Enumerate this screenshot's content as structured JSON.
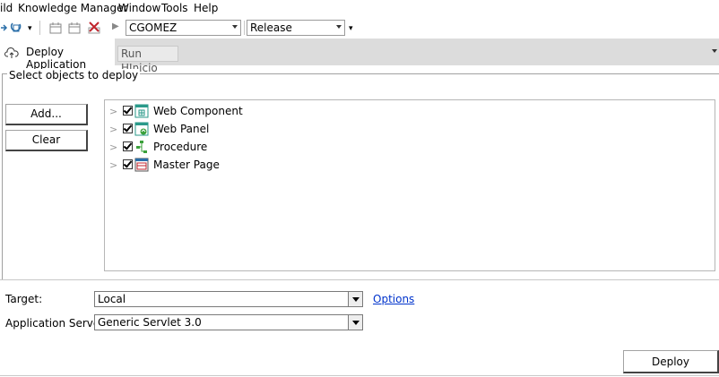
{
  "menubar": {
    "items": [
      "ild",
      "Knowledge Manager",
      "Window",
      "Tools",
      "Help"
    ]
  },
  "toolbar": {
    "user_combo": "CGOMEZ",
    "config_combo": "Release"
  },
  "tabs": {
    "deploy_label": "Deploy Application",
    "run_label": "Run HInicio"
  },
  "group": {
    "title": "Select objects to deploy",
    "add_button": "Add...",
    "clear_button": "Clear",
    "objects": [
      {
        "label": "Web Component",
        "checked": true,
        "icon": "web-component-icon"
      },
      {
        "label": "Web Panel",
        "checked": true,
        "icon": "web-panel-icon"
      },
      {
        "label": "Procedure",
        "checked": true,
        "icon": "procedure-icon"
      },
      {
        "label": "Master Page",
        "checked": true,
        "icon": "master-page-icon"
      }
    ]
  },
  "form": {
    "target_label": "Target:",
    "target_value": "Local",
    "options_link": "Options",
    "server_label": "Application Server:",
    "server_value": "Generic Servlet 3.0",
    "deploy_button": "Deploy"
  },
  "colors": {
    "tab_strip_bg": "#dcdcdc",
    "link": "#0033cc",
    "icon_teal": "#2a9a8a",
    "icon_green": "#3aa03a",
    "icon_red": "#c0242c"
  }
}
